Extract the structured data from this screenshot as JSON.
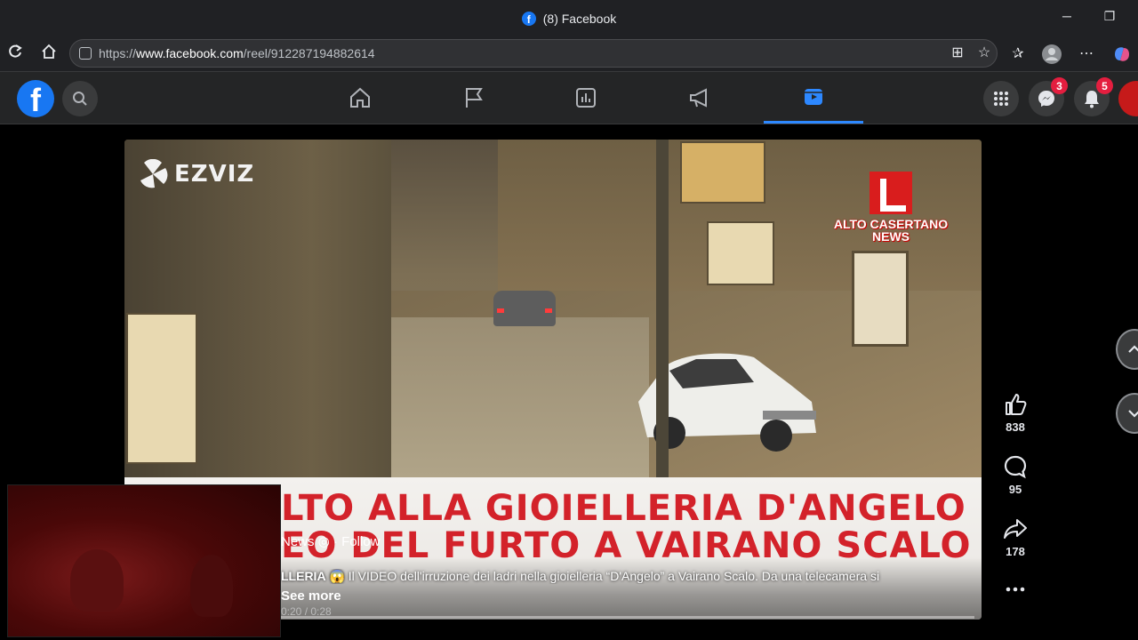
{
  "window": {
    "title": "(8) Facebook",
    "minimize_glyph": "─",
    "restore_glyph": "❐"
  },
  "browser": {
    "url_prefix": "https://",
    "url_host": "www.facebook.com",
    "url_path": "/reel/912287194882614"
  },
  "facebook": {
    "logo": "f",
    "nav_tabs": [
      "home-icon",
      "pages-flag-icon",
      "dashboard-icon",
      "ads-megaphone-icon",
      "reels-icon"
    ],
    "active_tab": "reels-icon",
    "messenger_badge": "3",
    "notifications_badge": "5"
  },
  "reel": {
    "watermark": "EZVIZ",
    "channel_logo_text": "ALTO CASERTANO NEWS",
    "headline_line1": "LTO ALLA GIOIELLERIA D'ANGELO",
    "headline_line2": "EO DEL FURTO A VAIRANO SCALO",
    "author_fragment": "News",
    "follow_label": "Follow",
    "caption_prefix": "LLERIA",
    "caption_text": "Il VIDEO dell'irruzione dei ladri nella gioielleria “D'Angelo” a Vairano Scalo. Da una telecamera si",
    "see_more": "See more",
    "timestamp_fragment": "0:20 / 0:28"
  },
  "actions": {
    "like_count": "838",
    "comment_count": "95",
    "share_count": "178"
  }
}
